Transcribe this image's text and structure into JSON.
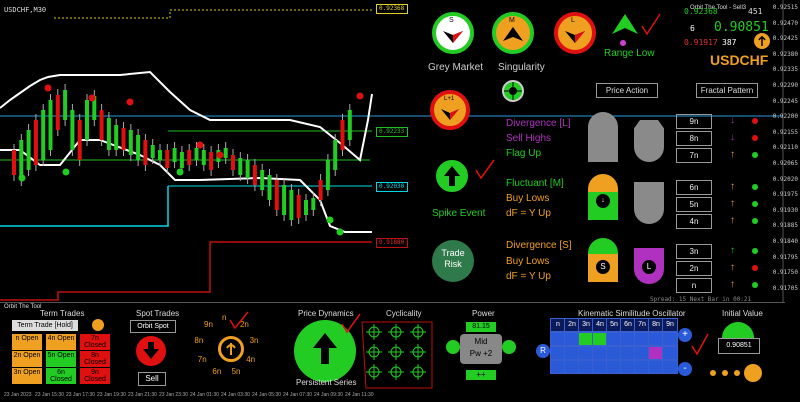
{
  "chart": {
    "symbol": "USDCHF,M30",
    "title_right": "Orbit The Tool - Sell3",
    "prices": {
      "p_top": "0.92368",
      "p_mid": "0.92233",
      "p_cyan": "0.92030",
      "p_red": "0.91880"
    },
    "axis": [
      "0.92515",
      "0.92470",
      "0.92425",
      "0.92380",
      "0.92335",
      "0.92290",
      "0.92245",
      "0.92200",
      "0.92155",
      "0.92110",
      "0.92065",
      "0.92020",
      "0.91975",
      "0.91930",
      "0.91885",
      "0.91840",
      "0.91795",
      "0.91750",
      "0.91705"
    ],
    "time_axis": [
      "23 Jan 2023",
      "23 Jan 15:30",
      "23 Jan 17:30",
      "23 Jan 19:30",
      "23 Jan 21:30",
      "23 Jan 23:30",
      "24 Jan 01:30",
      "24 Jan 03:30",
      "24 Jan 05:30",
      "24 Jan 07:30",
      "24 Jan 09:30",
      "24 Jan 11:30"
    ]
  },
  "header": {
    "bid": "0.92368",
    "spread_label": "6",
    "price_big": "0.90851",
    "ask": "0.91917",
    "count": "387",
    "count_top": "451",
    "pair": "USDCHF"
  },
  "signals": {
    "s_label": "S",
    "m_label": "M",
    "l_label": "L",
    "range_low": "Range Low",
    "grey_market": "Grey Market",
    "singularity": "Singularity",
    "l1_label": "L+1",
    "price_action": "Price Action",
    "fractal_pattern": "Fractal Pattern",
    "spike_event": "Spike Event",
    "trade_risk": "Trade Risk",
    "divergence_l": "Divergence [L]",
    "sell_highs": "Sell Highs",
    "flag_up": "Flag Up",
    "fluctuant_m": "Fluctuant [M]",
    "buy_lows_m": "Buy Lows",
    "df_m": "dF = Y Up",
    "divergence_s": "Divergence [S]",
    "buy_lows_s": "Buy Lows",
    "df_s": "dF = Y Up",
    "btn_down": "↓",
    "btn_s": "S",
    "btn_l": "L",
    "n_boxes": [
      "9n",
      "8n",
      "7n",
      "6n",
      "5n",
      "4n",
      "3n",
      "2n",
      "n"
    ],
    "spread_text": "Spread: 15 Next Bar in 00:21"
  },
  "bottom": {
    "orbit_tool": "Orbit The Tool",
    "term_trades": "Term Trades",
    "term_trade_hold": "Term Trade [Hold]",
    "term_labels": [
      "n Open",
      "4n Open",
      "7n Closed",
      "2n Open",
      "5n Open",
      "8n Closed",
      "3n Open",
      "6n Closed",
      "9n Closed"
    ],
    "spot_trades": "Spot Trades",
    "orbit_spot": "Orbit Spot",
    "sell": "Sell",
    "price_dynamics": "Price Dynamics",
    "persistent_series": "Persistent Series",
    "cyclicality": "Cyclicality",
    "power": "Power",
    "power_value": "81.15",
    "mid": "Mid",
    "pw": "Pw +2",
    "plus_plus": "++",
    "orbit_labels": [
      "n",
      "2n",
      "3n",
      "4n",
      "5n",
      "6n",
      "7n",
      "8n",
      "9n"
    ],
    "kso_title": "Kinematic Similitude Oscillator",
    "kso_headers": [
      "n",
      "2n",
      "3n",
      "4n",
      "5n",
      "6n",
      "7n",
      "8n",
      "9n"
    ],
    "kso_r": "R",
    "kso_plus": "+",
    "kso_minus": "-",
    "initial_value": "Initial Value",
    "initial_value_num": "0.90851"
  },
  "colors": {
    "green": "#22cc22",
    "red": "#e01010",
    "orange": "#f0a020",
    "cyan": "#00d8e8",
    "purple": "#b030c0",
    "blue": "#2a5ad8"
  }
}
